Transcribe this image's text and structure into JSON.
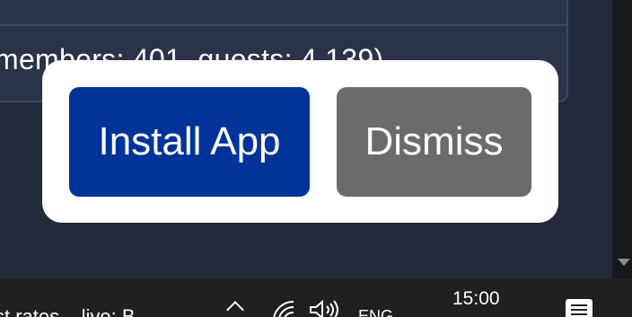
{
  "background": {
    "stats_text": "members: 401, guests: 4,139)"
  },
  "popup": {
    "install_label": "Install App",
    "dismiss_label": "Dismiss"
  },
  "taskbar": {
    "news_text": "st rates... live: B",
    "language": "ENG",
    "time": "15:00",
    "icons": [
      "chevron-up-icon",
      "wifi-icon",
      "volume-icon",
      "notification-icon"
    ]
  },
  "colors": {
    "install_button": "#003399",
    "dismiss_button": "#6b6b6b",
    "page_background": "#232a3b",
    "taskbar": "#202020"
  }
}
